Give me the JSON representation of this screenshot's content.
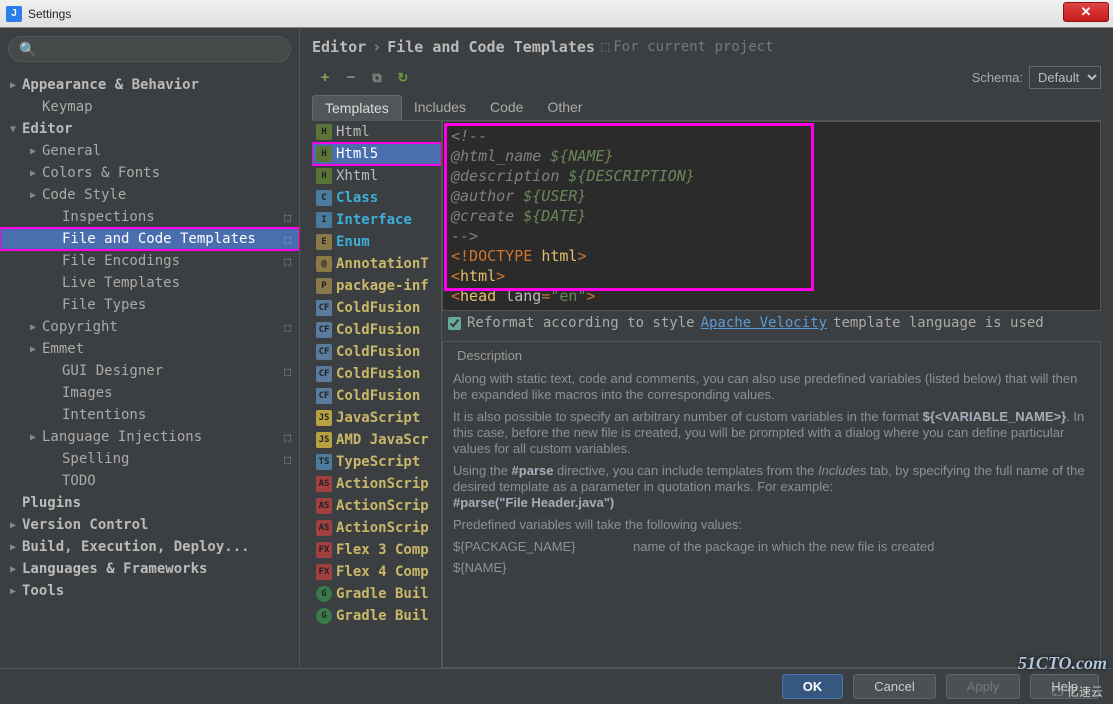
{
  "window": {
    "title": "Settings"
  },
  "sidebar": {
    "items": [
      {
        "label": "Appearance & Behavior",
        "level": 0,
        "bold": true,
        "arrow": "▶"
      },
      {
        "label": "Keymap",
        "level": 1,
        "bold": false
      },
      {
        "label": "Editor",
        "level": 0,
        "bold": true,
        "arrow": "▼"
      },
      {
        "label": "General",
        "level": 1,
        "arrow": "▶"
      },
      {
        "label": "Colors & Fonts",
        "level": 1,
        "arrow": "▶"
      },
      {
        "label": "Code Style",
        "level": 1,
        "arrow": "▶"
      },
      {
        "label": "Inspections",
        "level": 2,
        "project": true
      },
      {
        "label": "File and Code Templates",
        "level": 2,
        "selected": true,
        "project": true,
        "highlight": true
      },
      {
        "label": "File Encodings",
        "level": 2,
        "project": true
      },
      {
        "label": "Live Templates",
        "level": 2
      },
      {
        "label": "File Types",
        "level": 2
      },
      {
        "label": "Copyright",
        "level": 1,
        "arrow": "▶",
        "project": true
      },
      {
        "label": "Emmet",
        "level": 1,
        "arrow": "▶"
      },
      {
        "label": "GUI Designer",
        "level": 2,
        "project": true
      },
      {
        "label": "Images",
        "level": 2
      },
      {
        "label": "Intentions",
        "level": 2
      },
      {
        "label": "Language Injections",
        "level": 1,
        "arrow": "▶",
        "project": true
      },
      {
        "label": "Spelling",
        "level": 2,
        "project": true
      },
      {
        "label": "TODO",
        "level": 2
      },
      {
        "label": "Plugins",
        "level": 0,
        "bold": true
      },
      {
        "label": "Version Control",
        "level": 0,
        "bold": true,
        "arrow": "▶"
      },
      {
        "label": "Build, Execution, Deploy...",
        "level": 0,
        "bold": true,
        "arrow": "▶"
      },
      {
        "label": "Languages & Frameworks",
        "level": 0,
        "bold": true,
        "arrow": "▶"
      },
      {
        "label": "Tools",
        "level": 0,
        "bold": true,
        "arrow": "▶"
      }
    ]
  },
  "breadcrumb": {
    "part1": "Editor",
    "part2": "File and Code Templates",
    "note": "For current project"
  },
  "schema": {
    "label": "Schema:",
    "value": "Default"
  },
  "tabs": [
    "Templates",
    "Includes",
    "Code",
    "Other"
  ],
  "active_tab": 0,
  "templates": [
    {
      "label": "Html",
      "icon": "H",
      "cls": ""
    },
    {
      "label": "Html5",
      "icon": "H",
      "cls": "",
      "selected": true,
      "highlight": true
    },
    {
      "label": "Xhtml",
      "icon": "H",
      "cls": ""
    },
    {
      "label": "Class",
      "icon": "C",
      "cls": "bold cyan",
      "iconcls": "int"
    },
    {
      "label": "Interface",
      "icon": "I",
      "cls": "bold cyan",
      "iconcls": "int"
    },
    {
      "label": "Enum",
      "icon": "E",
      "cls": "bold cyan",
      "iconcls": "en"
    },
    {
      "label": "AnnotationT",
      "icon": "@",
      "cls": "bold",
      "iconcls": "en"
    },
    {
      "label": "package-inf",
      "icon": "P",
      "cls": "bold",
      "iconcls": "en"
    },
    {
      "label": "ColdFusion",
      "icon": "CF",
      "cls": "bold",
      "iconcls": "cf"
    },
    {
      "label": "ColdFusion",
      "icon": "CF",
      "cls": "bold",
      "iconcls": "cf"
    },
    {
      "label": "ColdFusion",
      "icon": "CF",
      "cls": "bold",
      "iconcls": "cf"
    },
    {
      "label": "ColdFusion",
      "icon": "CF",
      "cls": "bold",
      "iconcls": "cf"
    },
    {
      "label": "ColdFusion",
      "icon": "CF",
      "cls": "bold",
      "iconcls": "cf"
    },
    {
      "label": "JavaScript",
      "icon": "JS",
      "cls": "bold",
      "iconcls": "js"
    },
    {
      "label": "AMD JavaScr",
      "icon": "JS",
      "cls": "bold",
      "iconcls": "js"
    },
    {
      "label": "TypeScript",
      "icon": "TS",
      "cls": "bold",
      "iconcls": "int"
    },
    {
      "label": "ActionScrip",
      "icon": "AS",
      "cls": "bold",
      "iconcls": "as"
    },
    {
      "label": "ActionScrip",
      "icon": "AS",
      "cls": "bold",
      "iconcls": "as"
    },
    {
      "label": "ActionScrip",
      "icon": "AS",
      "cls": "bold",
      "iconcls": "as"
    },
    {
      "label": "Flex 3 Comp",
      "icon": "FX",
      "cls": "bold",
      "iconcls": "as"
    },
    {
      "label": "Flex 4 Comp",
      "icon": "FX",
      "cls": "bold",
      "iconcls": "as"
    },
    {
      "label": "Gradle Buil",
      "icon": "G",
      "cls": "bold",
      "iconcls": "gr"
    },
    {
      "label": "Gradle Buil",
      "icon": "G",
      "cls": "bold",
      "iconcls": "gr"
    }
  ],
  "code": {
    "lines": [
      {
        "t": "<!--",
        "cls": "c-comment"
      },
      {
        "pre": "  @html_name ",
        "var": "${NAME}"
      },
      {
        "pre": "  @description  ",
        "var": "${DESCRIPTION}"
      },
      {
        "pre": "  @author ",
        "var": "${USER}"
      },
      {
        "pre": "  @create  ",
        "var": "${DATE}"
      },
      {
        "t": "-->",
        "cls": "c-comment"
      },
      {
        "t": ""
      },
      {
        "doctype": "<!DOCTYPE ",
        "val": "html",
        "end": ">"
      },
      {
        "tag": "<",
        "name": "html",
        "end": ">"
      },
      {
        "tag": "<",
        "name": "head ",
        "attr": "lang",
        "eq": "=",
        "str": "\"en\"",
        "end": ">"
      }
    ]
  },
  "reformat": {
    "checkbox_label": "Reformat according to style",
    "link": "Apache Velocity",
    "trail": " template language is used"
  },
  "description": {
    "title": "Description",
    "p1": "Along with static text, code and comments, you can also use predefined variables (listed below) that will then be expanded like macros into the corresponding values.",
    "p2a": "It is also possible to specify an arbitrary number of custom variables in the format ",
    "p2b": "${<VARIABLE_NAME>}",
    "p2c": ". In this case, before the new file is created, you will be prompted with a dialog where you can define particular values for all custom variables.",
    "p3a": "Using the ",
    "p3b": "#parse",
    "p3c": " directive, you can include templates from the ",
    "p3d": "Includes",
    "p3e": " tab, by specifying the full name of the desired template as a parameter in quotation marks. For example:",
    "p3f": "#parse(\"File Header.java\")",
    "p4": " Predefined variables will take the following values:",
    "var1": "${PACKAGE_NAME}",
    "var1desc": "name of the package in which the new file is created",
    "var2": "${NAME}",
    "var2desc": ""
  },
  "footer": {
    "ok": "OK",
    "cancel": "Cancel",
    "apply": "Apply",
    "help": "Help"
  },
  "watermark": "51CTO.com"
}
